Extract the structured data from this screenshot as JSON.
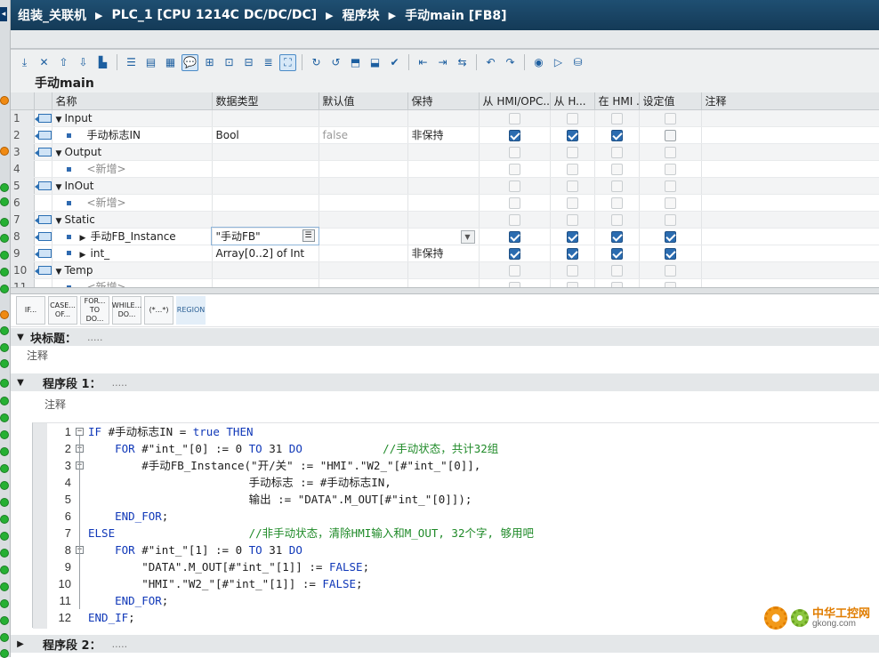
{
  "breadcrumb": [
    "组装_关联机",
    "PLC_1 [CPU 1214C DC/DC/DC]",
    "程序块",
    "手动main [FB8]"
  ],
  "block_name": "手动main",
  "interface": {
    "columns": [
      "名称",
      "数据类型",
      "默认值",
      "保持",
      "从 HMI/OPC...",
      "从 H...",
      "在 HMI ...",
      "设定值",
      "注释"
    ],
    "rows": [
      {
        "num": "1",
        "type": "section",
        "name": "Input"
      },
      {
        "num": "2",
        "type": "var",
        "name": "手动标志IN",
        "datatype": "Bool",
        "default": "false",
        "retain": "非保持",
        "checks": [
          true,
          true,
          true,
          false
        ]
      },
      {
        "num": "3",
        "type": "section",
        "name": "Output"
      },
      {
        "num": "4",
        "type": "new",
        "name": "<新增>"
      },
      {
        "num": "5",
        "type": "section",
        "name": "InOut"
      },
      {
        "num": "6",
        "type": "new",
        "name": "<新增>"
      },
      {
        "num": "7",
        "type": "section",
        "name": "Static"
      },
      {
        "num": "8",
        "type": "struct",
        "name": "手动FB_Instance",
        "datatype": "\"手动FB\"",
        "default": "",
        "retain": "",
        "checks": [
          true,
          true,
          true,
          true
        ]
      },
      {
        "num": "9",
        "type": "struct",
        "name": "int_",
        "datatype": "Array[0..2] of Int",
        "default": "",
        "retain": "非保持",
        "checks": [
          true,
          true,
          true,
          true
        ]
      },
      {
        "num": "10",
        "type": "section",
        "name": "Temp"
      },
      {
        "num": "11",
        "type": "new",
        "name": "<新增>"
      }
    ]
  },
  "instructions": [
    "IF...",
    "CASE...\nOF...",
    "FOR...\nTO DO...",
    "WHILE...\nDO...",
    "(*...*)",
    "REGION"
  ],
  "block_title": {
    "label": "块标题：",
    "dots": ".....",
    "comment": "注释"
  },
  "network1": {
    "label": "程序段 1：",
    "dots": ".....",
    "comment": "注释"
  },
  "network2": {
    "label": "程序段 2：",
    "dots": "....."
  },
  "code": [
    {
      "n": "1",
      "fold": "minus",
      "text": "IF #手动标志IN = true THEN"
    },
    {
      "n": "2",
      "fold": "minus",
      "text": "    FOR #\"int_\"[0] := 0 TO 31 DO            //手动状态，共计32组"
    },
    {
      "n": "3",
      "fold": "minus",
      "text": "        #手动FB_Instance(\"开/关\" := \"HMI\".\"W2_\"[#\"int_\"[0]],"
    },
    {
      "n": "4",
      "fold": "",
      "text": "                        手动标志 := #手动标志IN,"
    },
    {
      "n": "5",
      "fold": "",
      "text": "                        输出 := \"DATA\".M_OUT[#\"int_\"[0]]);"
    },
    {
      "n": "6",
      "fold": "end",
      "text": "    END_FOR;"
    },
    {
      "n": "7",
      "fold": "",
      "text": "ELSE                    //非手动状态，清除HMI输入和M_OUT, 32个字, 够用吧"
    },
    {
      "n": "8",
      "fold": "minus",
      "text": "    FOR #\"int_\"[1] := 0 TO 31 DO"
    },
    {
      "n": "9",
      "fold": "",
      "text": "        \"DATA\".M_OUT[#\"int_\"[1]] := FALSE;"
    },
    {
      "n": "10",
      "fold": "",
      "text": "        \"HMI\".\"W2_\"[#\"int_\"[1]] := FALSE;"
    },
    {
      "n": "11",
      "fold": "end",
      "text": "    END_FOR;"
    },
    {
      "n": "12",
      "fold": "end",
      "text": "END_IF;"
    }
  ],
  "watermark": {
    "name": "中华工控网",
    "url": "gkong.com"
  },
  "colors": {
    "title_bar": "#1f4f72",
    "keyword": "#1038b8",
    "comment": "#1f8a28",
    "checkbox": "#2b6cb0"
  }
}
